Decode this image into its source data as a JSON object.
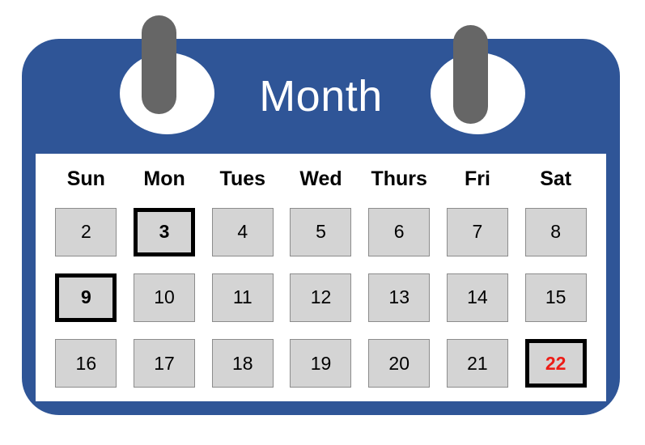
{
  "colors": {
    "brand_blue": "#2f5597",
    "page_white": "#ffffff",
    "cell_gray": "#d4d4d4",
    "cell_border_gray": "#8c8c8c",
    "selected_border": "#000000",
    "accent_red": "#ed1c16",
    "ring_gray": "#666666"
  },
  "header": {
    "title": "Month",
    "rings": [
      {
        "name": "binder-ring-left"
      },
      {
        "name": "binder-ring-right"
      }
    ]
  },
  "weekdays": [
    {
      "label": "Sun"
    },
    {
      "label": "Mon"
    },
    {
      "label": "Tues"
    },
    {
      "label": "Wed"
    },
    {
      "label": "Thurs"
    },
    {
      "label": "Fri"
    },
    {
      "label": "Sat"
    }
  ],
  "weeks": [
    {
      "days": [
        {
          "date": "2",
          "weekday": "Sun",
          "selected": false,
          "accent": false
        },
        {
          "date": "3",
          "weekday": "Mon",
          "selected": true,
          "accent": false
        },
        {
          "date": "4",
          "weekday": "Tues",
          "selected": false,
          "accent": false
        },
        {
          "date": "5",
          "weekday": "Wed",
          "selected": false,
          "accent": false
        },
        {
          "date": "6",
          "weekday": "Thurs",
          "selected": false,
          "accent": false
        },
        {
          "date": "7",
          "weekday": "Fri",
          "selected": false,
          "accent": false
        },
        {
          "date": "8",
          "weekday": "Sat",
          "selected": false,
          "accent": false
        }
      ]
    },
    {
      "days": [
        {
          "date": "9",
          "weekday": "Sun",
          "selected": true,
          "accent": false
        },
        {
          "date": "10",
          "weekday": "Mon",
          "selected": false,
          "accent": false
        },
        {
          "date": "11",
          "weekday": "Tues",
          "selected": false,
          "accent": false
        },
        {
          "date": "12",
          "weekday": "Wed",
          "selected": false,
          "accent": false
        },
        {
          "date": "13",
          "weekday": "Thurs",
          "selected": false,
          "accent": false
        },
        {
          "date": "14",
          "weekday": "Fri",
          "selected": false,
          "accent": false
        },
        {
          "date": "15",
          "weekday": "Sat",
          "selected": false,
          "accent": false
        }
      ]
    },
    {
      "days": [
        {
          "date": "16",
          "weekday": "Sun",
          "selected": false,
          "accent": false
        },
        {
          "date": "17",
          "weekday": "Mon",
          "selected": false,
          "accent": false
        },
        {
          "date": "18",
          "weekday": "Tues",
          "selected": false,
          "accent": false
        },
        {
          "date": "19",
          "weekday": "Wed",
          "selected": false,
          "accent": false
        },
        {
          "date": "20",
          "weekday": "Thurs",
          "selected": false,
          "accent": false
        },
        {
          "date": "21",
          "weekday": "Fri",
          "selected": false,
          "accent": false
        },
        {
          "date": "22",
          "weekday": "Sat",
          "selected": true,
          "accent": true
        }
      ]
    }
  ]
}
